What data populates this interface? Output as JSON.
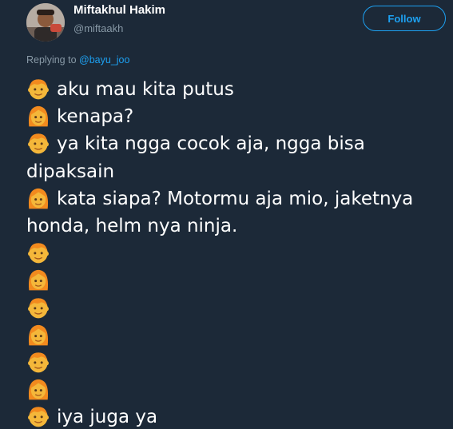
{
  "tweet": {
    "author_name": "Miftakhul Hakim",
    "author_handle": "@miftaakh",
    "follow_label": "Follow",
    "replying_prefix": "Replying to",
    "replying_to": "@bayu_joo",
    "lines": [
      {
        "emoji": "boy-emoji",
        "text": "aku mau kita putus"
      },
      {
        "emoji": "girl-emoji",
        "text": "kenapa?"
      },
      {
        "emoji": "boy-emoji",
        "text": "ya kita ngga cocok aja, ngga bisa dipaksain"
      },
      {
        "emoji": "girl-emoji",
        "text": "kata siapa? Motormu aja mio, jaketnya honda, helm nya ninja."
      },
      {
        "emoji": "boy-emoji",
        "text": ""
      },
      {
        "emoji": "girl-emoji",
        "text": ""
      },
      {
        "emoji": "boy-emoji",
        "text": ""
      },
      {
        "emoji": "girl-emoji",
        "text": ""
      },
      {
        "emoji": "boy-emoji",
        "text": ""
      },
      {
        "emoji": "girl-emoji",
        "text": ""
      },
      {
        "emoji": "boy-emoji",
        "text": "iya juga ya"
      }
    ]
  },
  "colors": {
    "background": "#1c2938",
    "accent": "#1da1f2",
    "secondary_text": "#8899a6"
  }
}
